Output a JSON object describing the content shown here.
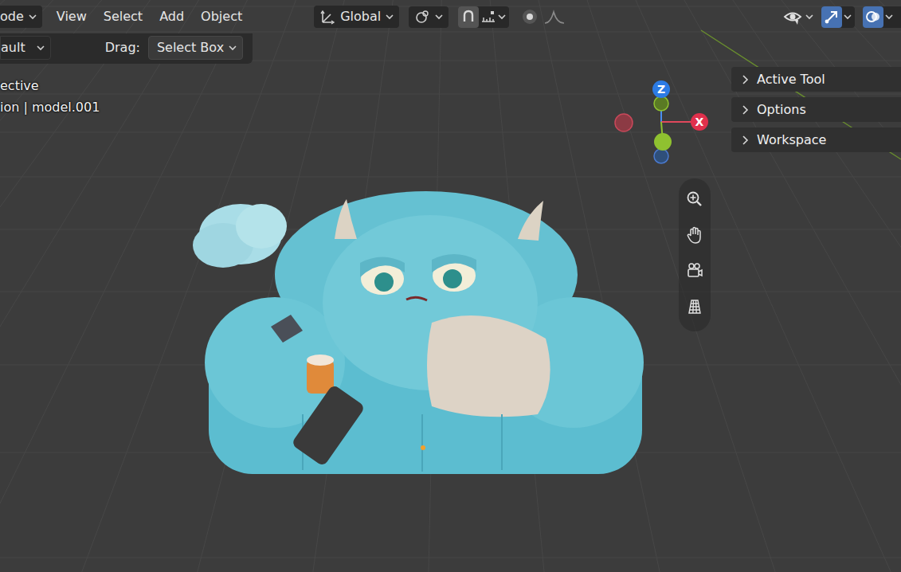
{
  "header": {
    "mode": "ode",
    "menus": [
      "View",
      "Select",
      "Add",
      "Object"
    ],
    "orientation": "Global",
    "toggles": [
      {
        "on": true
      },
      {
        "on": false
      },
      {
        "on": true
      },
      {
        "on": true
      }
    ]
  },
  "toolbar": {
    "transform": "ault",
    "drag_label": "Drag:",
    "drag_value": "Select Box"
  },
  "viewport": {
    "overlay": [
      "ective",
      "ion | model.001"
    ],
    "gizmo": {
      "z": "Z",
      "x": "X"
    },
    "sidebar_tabs": [
      {
        "label": "Active Tool",
        "expanded": false
      },
      {
        "label": "Options",
        "expanded": false
      },
      {
        "label": "Workspace",
        "expanded": false
      }
    ]
  }
}
